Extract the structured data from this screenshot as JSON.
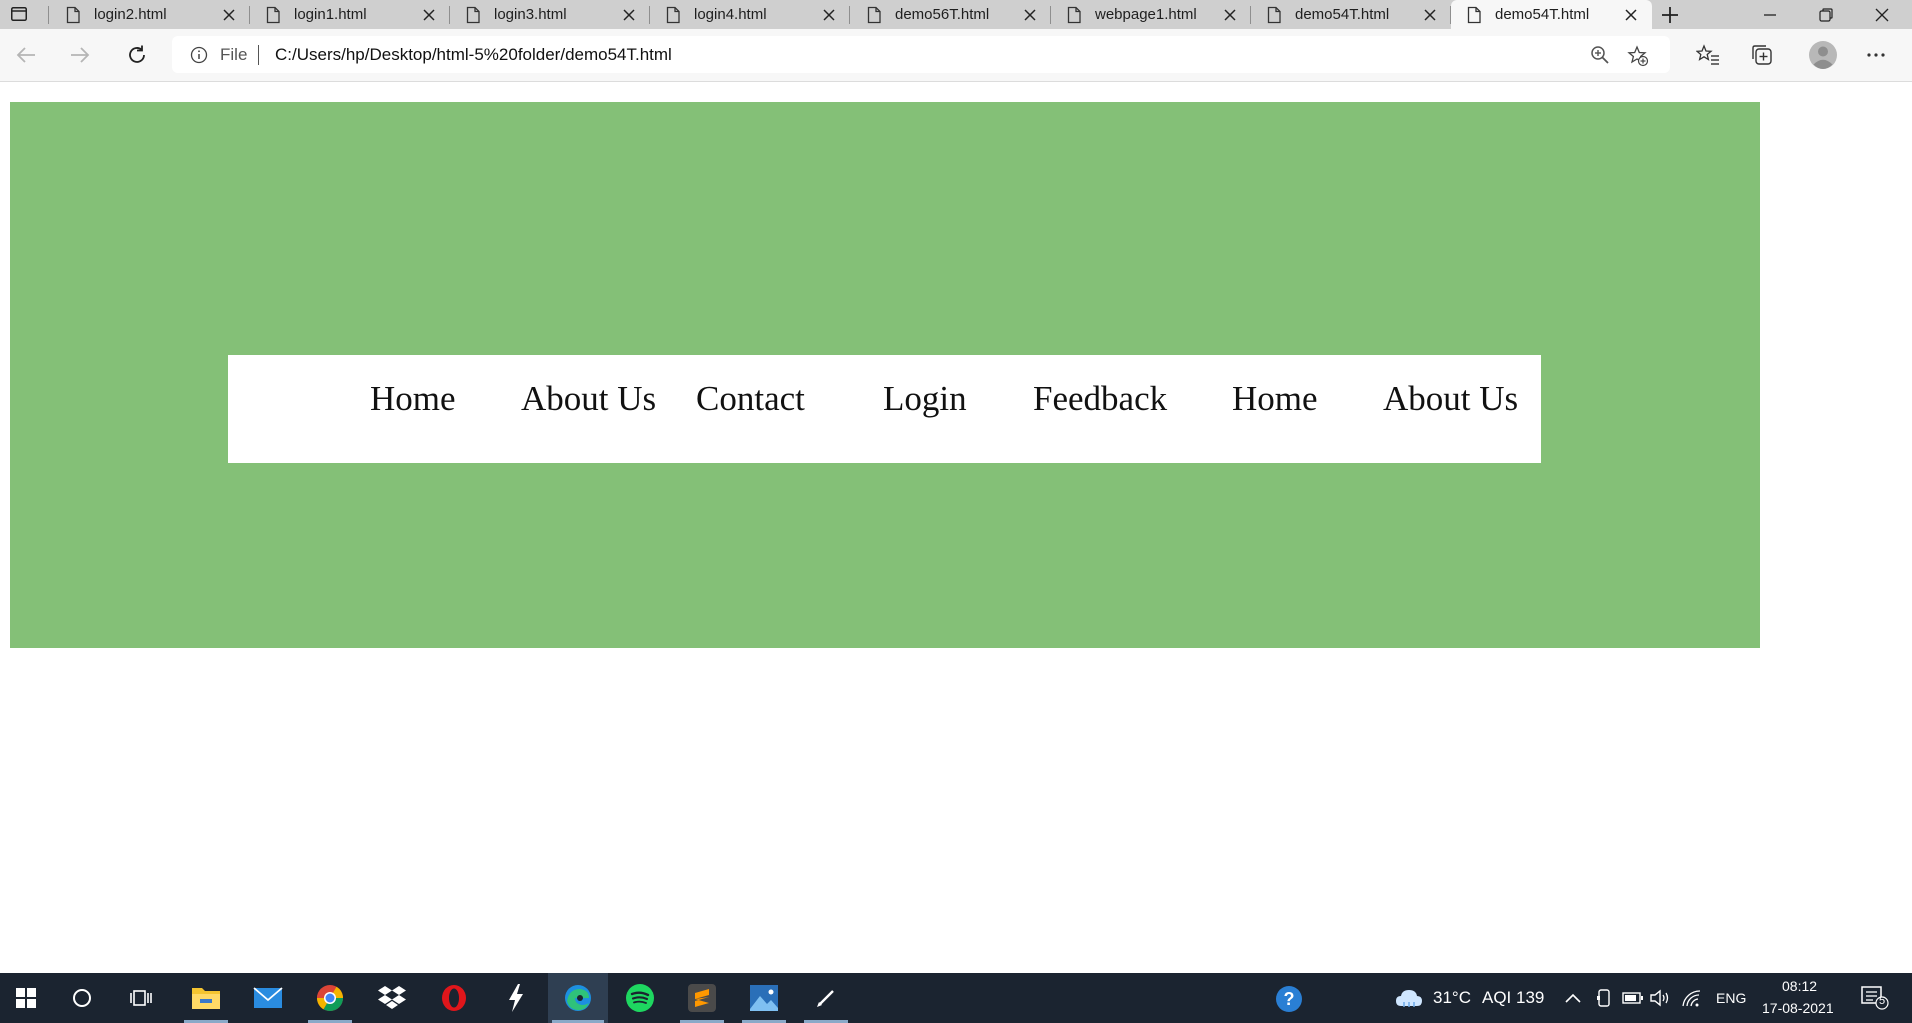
{
  "browser": {
    "tabs": [
      {
        "title": "login2.html",
        "active": false
      },
      {
        "title": "login1.html",
        "active": false
      },
      {
        "title": "login3.html",
        "active": false
      },
      {
        "title": "login4.html",
        "active": false
      },
      {
        "title": "demo56T.html",
        "active": false
      },
      {
        "title": "webpage1.html",
        "active": false
      },
      {
        "title": "demo54T.html",
        "active": false
      },
      {
        "title": "demo54T.html",
        "active": true
      }
    ],
    "address": {
      "scheme_label": "File",
      "url": "C:/Users/hp/Desktop/html-5%20folder/demo54T.html"
    }
  },
  "page": {
    "banner_color": "#84c077",
    "nav_links": [
      "Home",
      "About Us",
      "Contact",
      "Login",
      "Feedback",
      "Home",
      "About Us"
    ]
  },
  "taskbar": {
    "weather": "31°C",
    "aqi": "AQI 139",
    "language": "ENG",
    "time": "08:12",
    "date": "17-08-2021",
    "notification_count": "5"
  },
  "icons": {
    "window_menu": "window-menu-icon",
    "tab_doc": "document-icon",
    "close": "close-icon",
    "new_tab": "plus-icon",
    "minimize": "minimize-icon",
    "restore": "restore-icon",
    "back": "back-arrow-icon",
    "forward": "forward-arrow-icon",
    "refresh": "refresh-icon",
    "info": "info-icon",
    "zoom": "zoom-icon",
    "add_favorite": "add-favorite-icon",
    "favorites": "favorites-icon",
    "collections": "collections-icon",
    "profile": "profile-avatar",
    "more": "more-icon"
  }
}
